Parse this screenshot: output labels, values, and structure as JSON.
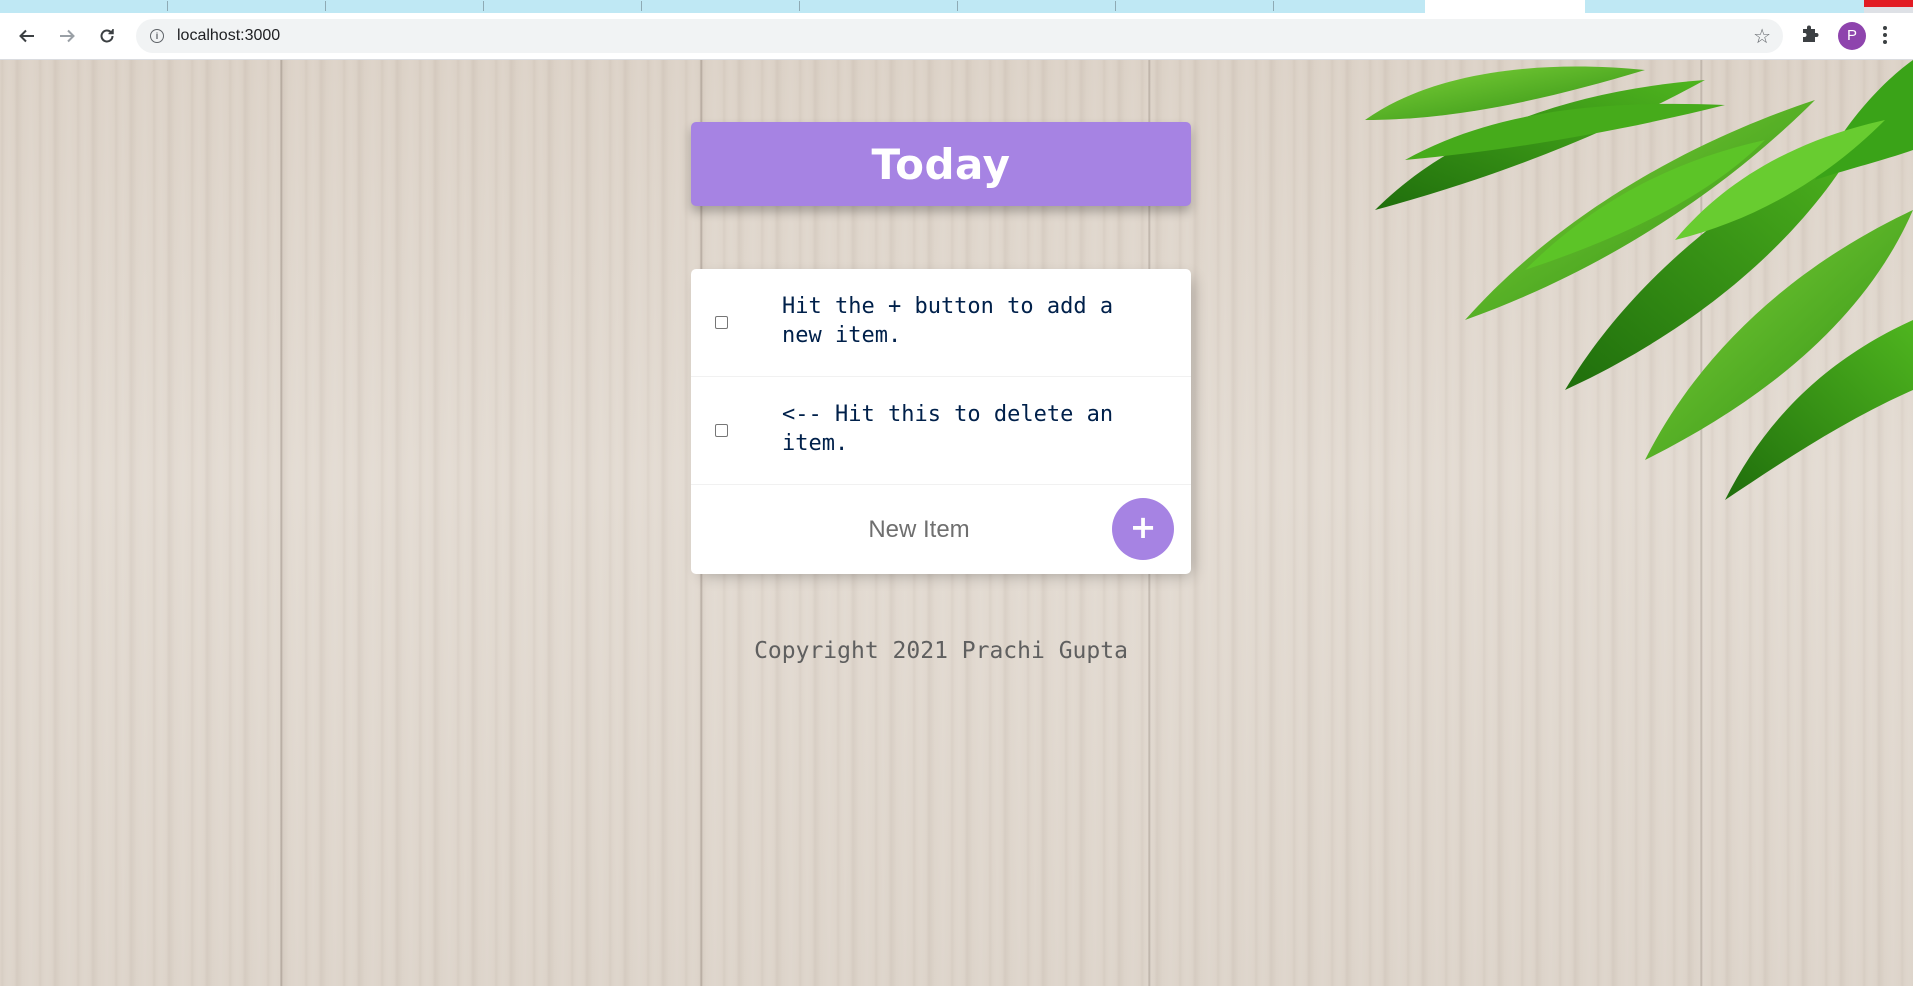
{
  "browser": {
    "url": "localhost:3000",
    "profile_initial": "P",
    "icons": {
      "back": "arrow-left-icon",
      "forward": "arrow-right-icon",
      "reload": "reload-icon",
      "info": "info-icon",
      "bookmark": "star-icon",
      "extensions": "puzzle-icon",
      "menu": "kebab-menu-icon"
    }
  },
  "app": {
    "title": "Today",
    "items": [
      {
        "text": "Hit the + button to add a new item."
      },
      {
        "text": "<-- Hit this to delete an item."
      }
    ],
    "new_item_placeholder": "New Item",
    "add_button_label": "+",
    "footer": "Copyright 2021 Prachi Gupta",
    "colors": {
      "accent": "#a683e3",
      "text": "#00204a"
    }
  }
}
